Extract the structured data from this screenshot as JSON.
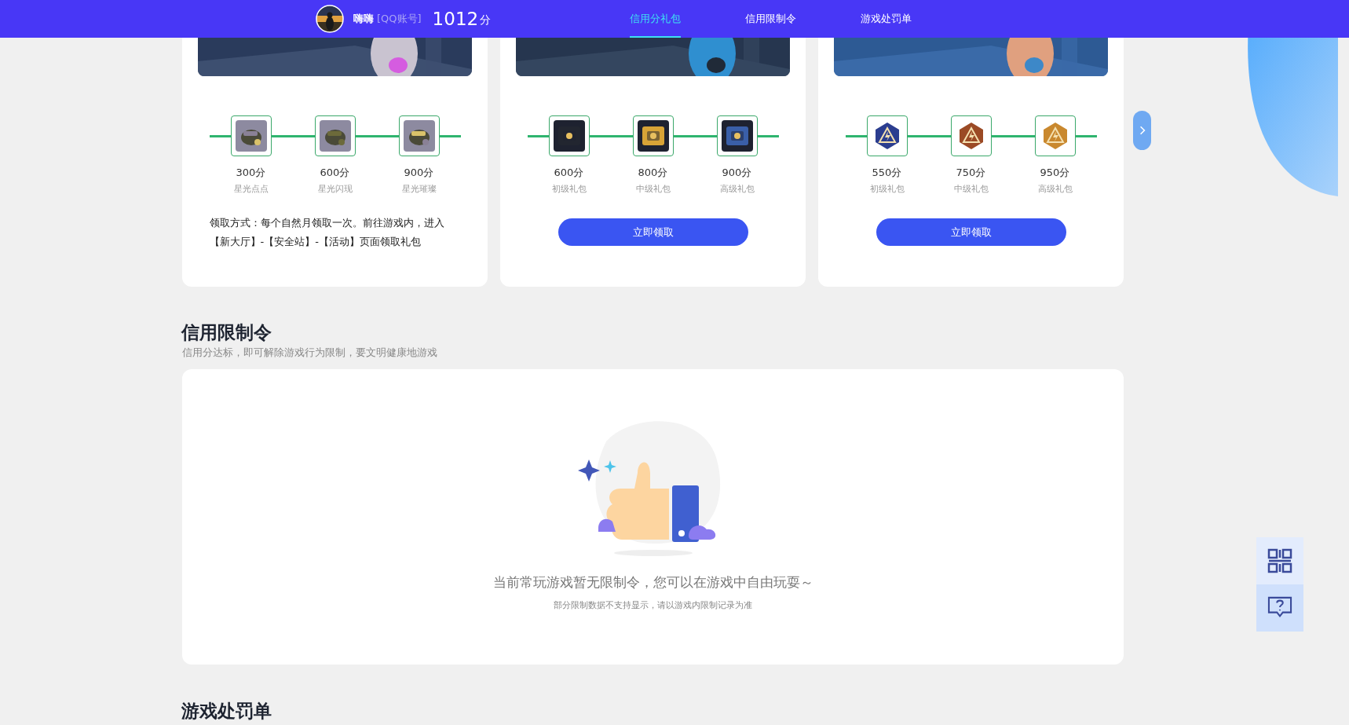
{
  "header": {
    "username": "嗨嗨",
    "account_type": "[QQ账号]",
    "score": "1012",
    "score_unit": "分",
    "nav": [
      {
        "label": "信用分礼包",
        "selected": true
      },
      {
        "label": "信用限制令",
        "selected": false
      },
      {
        "label": "游戏处罚单",
        "selected": false
      }
    ]
  },
  "gift_cards": [
    {
      "kind": "note",
      "rewards": [
        {
          "points": "300分",
          "name": "星光点点"
        },
        {
          "points": "600分",
          "name": "星光闪现"
        },
        {
          "points": "900分",
          "name": "星光璀璨"
        }
      ],
      "note": "领取方式：每个自然月领取一次。前往游戏内，进入【新大厅】-【安全站】-【活动】页面领取礼包"
    },
    {
      "kind": "button",
      "rewards": [
        {
          "points": "600分",
          "name": "初级礼包"
        },
        {
          "points": "800分",
          "name": "中级礼包"
        },
        {
          "points": "900分",
          "name": "高级礼包"
        }
      ],
      "button": "立即领取"
    },
    {
      "kind": "button",
      "rewards": [
        {
          "points": "550分",
          "name": "初级礼包"
        },
        {
          "points": "750分",
          "name": "中级礼包"
        },
        {
          "points": "950分",
          "name": "高级礼包"
        }
      ],
      "button": "立即领取"
    }
  ],
  "restriction_section": {
    "title": "信用限制令",
    "subtitle": "信用分达标，即可解除游戏行为限制，要文明健康地游戏",
    "empty_message": "当前常玩游戏暂无限制令，您可以在游戏中自由玩耍～",
    "empty_note": "部分限制数据不支持显示，请以游戏内限制记录为准"
  },
  "penalty_section": {
    "title": "游戏处罚单"
  }
}
